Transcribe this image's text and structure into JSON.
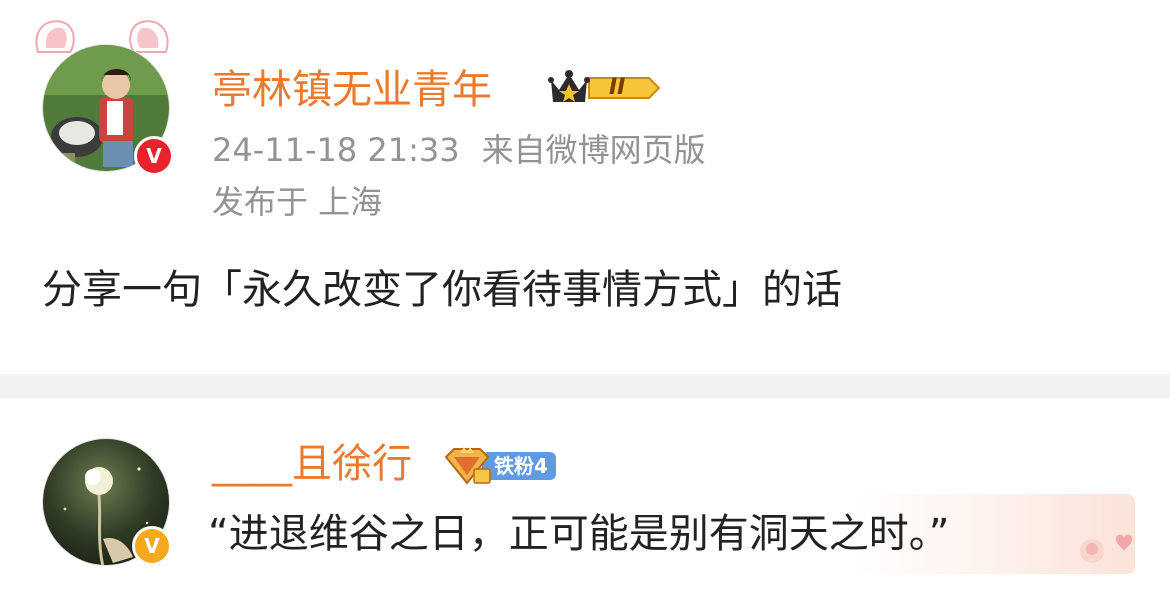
{
  "post": {
    "author": "亭林镇无业青年",
    "level_badge": "II",
    "timestamp": "24-11-18 21:33",
    "source": "来自微博网页版",
    "location": "发布于 上海",
    "text": "分享一句「永久改变了你看待事情方式」的话"
  },
  "comment": {
    "author": "____且徐行",
    "fan_badge": "铁粉4",
    "text": "“进退维谷之日，正可能是别有洞天之时。”"
  },
  "colors": {
    "username": "#ec7a2e",
    "meta": "#939393",
    "verified_red": "#e8232d",
    "verified_gold": "#f6a91c",
    "fan_badge": "#5e9be3",
    "divider": "#f2f2f2"
  }
}
